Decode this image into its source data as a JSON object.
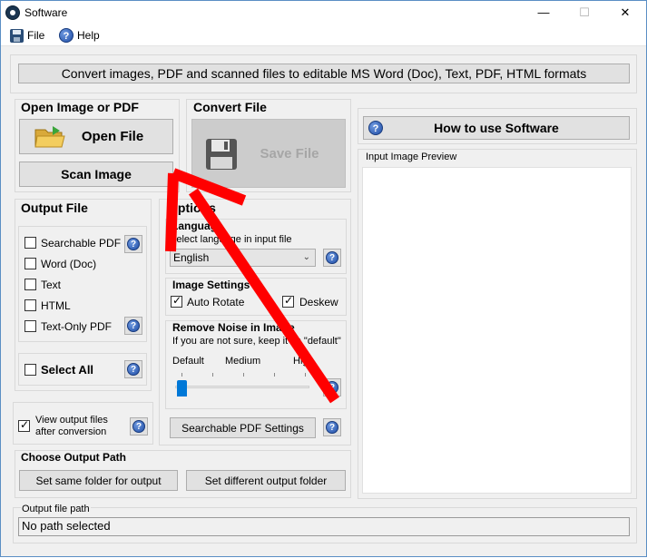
{
  "window": {
    "title": "Software",
    "min": "—",
    "max": "☐",
    "close": "✕"
  },
  "menu": {
    "file": "File",
    "help": "Help"
  },
  "banner": "Convert images, PDF and scanned files to editable MS Word (Doc), Text, PDF, HTML formats",
  "open": {
    "title": "Open Image or PDF",
    "open_file": "Open File",
    "scan_image": "Scan Image"
  },
  "convert": {
    "title": "Convert File",
    "save_file": "Save File"
  },
  "how_to": "How to use Software",
  "preview": {
    "label": "Input Image Preview"
  },
  "output_file": {
    "title": "Output File",
    "items": [
      {
        "label": "Searchable PDF",
        "checked": false,
        "help": true
      },
      {
        "label": "Word (Doc)",
        "checked": false,
        "help": false
      },
      {
        "label": "Text",
        "checked": false,
        "help": false
      },
      {
        "label": "HTML",
        "checked": false,
        "help": false
      },
      {
        "label": "Text-Only PDF",
        "checked": false,
        "help": true
      }
    ],
    "select_all": "Select All"
  },
  "view_output": {
    "line1": "View output files",
    "line2": "after conversion",
    "checked": true
  },
  "options": {
    "title": "Options",
    "language_title": "Language",
    "language_hint": "Select language in input file",
    "language_value": "English",
    "image_settings_title": "Image Settings",
    "auto_rotate": "Auto Rotate",
    "auto_rotate_checked": true,
    "deskew": "Deskew",
    "deskew_checked": true,
    "noise_title": "Remove Noise in Image",
    "noise_hint": "If you are not sure, keep it as \"default\"",
    "noise_levels": [
      "Default",
      "Medium",
      "High"
    ],
    "noise_level": 0,
    "pdf_settings": "Searchable PDF Settings"
  },
  "output_path": {
    "title": "Choose Output Path",
    "same_folder": "Set same folder for output",
    "different_folder": "Set different output folder",
    "path_label": "Output file path",
    "path_value": "No path selected"
  },
  "colors": {
    "arrow": "#ff0000",
    "accent": "#0078d7"
  }
}
